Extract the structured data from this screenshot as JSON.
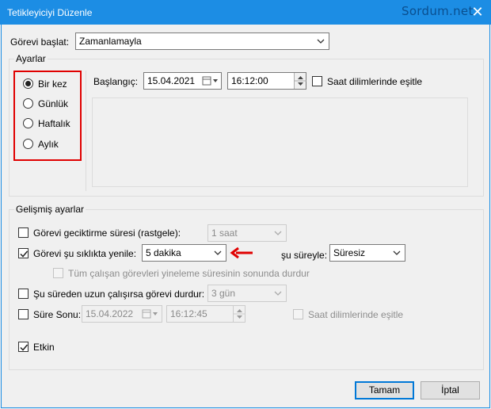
{
  "window": {
    "title": "Tetikleyiciyi Düzenle",
    "watermark": "Sordum.net",
    "close_glyph": "✕"
  },
  "start_task": {
    "label": "Görevi başlat:",
    "value": "Zamanlamayla"
  },
  "settings": {
    "legend": "Ayarlar",
    "schedule_options": [
      "Bir kez",
      "Günlük",
      "Haftalık",
      "Aylık"
    ],
    "selected_option": "Bir kez",
    "start_label": "Başlangıç:",
    "start_date": "15.04.2021",
    "start_time": "16:12:00",
    "sync_timezones_label": "Saat dilimlerinde eşitle",
    "sync_timezones_checked": false
  },
  "advanced": {
    "legend": "Gelişmiş ayarlar",
    "delay": {
      "label": "Görevi geciktirme süresi (rastgele):",
      "checked": false,
      "value": "1 saat"
    },
    "repeat": {
      "label": "Görevi şu sıklıkta yenile:",
      "checked": true,
      "value": "5 dakika",
      "duration_label": "şu süreyle:",
      "duration_value": "Süresiz"
    },
    "stop_all_running": {
      "label": "Tüm çalışan görevleri yineleme süresinin sonunda durdur",
      "checked": false
    },
    "stop_if_longer": {
      "label": "Şu süreden uzun çalışırsa görevi durdur:",
      "checked": false,
      "value": "3 gün"
    },
    "expire": {
      "label": "Süre Sonu:",
      "checked": false,
      "date": "15.04.2022",
      "time": "16:12:45",
      "sync_label": "Saat dilimlerinde eşitle"
    },
    "enabled": {
      "label": "Etkin",
      "checked": true
    }
  },
  "buttons": {
    "ok": "Tamam",
    "cancel": "İptal"
  },
  "colors": {
    "titlebar": "#1c8de4",
    "highlight_red": "#e00000",
    "accent": "#0078d7"
  }
}
